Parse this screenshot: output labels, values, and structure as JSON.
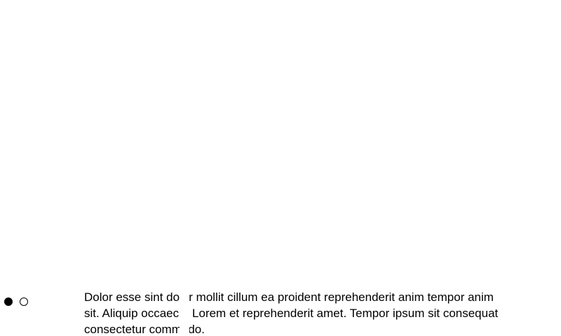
{
  "carousel": {
    "dots": [
      {
        "state": "active"
      },
      {
        "state": "inactive"
      }
    ],
    "caption": "Dolor esse sint dolor mollit cillum ea proident reprehenderit anim tempor anim sit. Aliquip occaecat Lorem et reprehenderit amet. Tempor ipsum sit consequat consectetur commodo."
  },
  "colors": {
    "background": "#ffffff",
    "text": "#000000",
    "dot_active": "#000000",
    "dot_border": "#000000"
  }
}
